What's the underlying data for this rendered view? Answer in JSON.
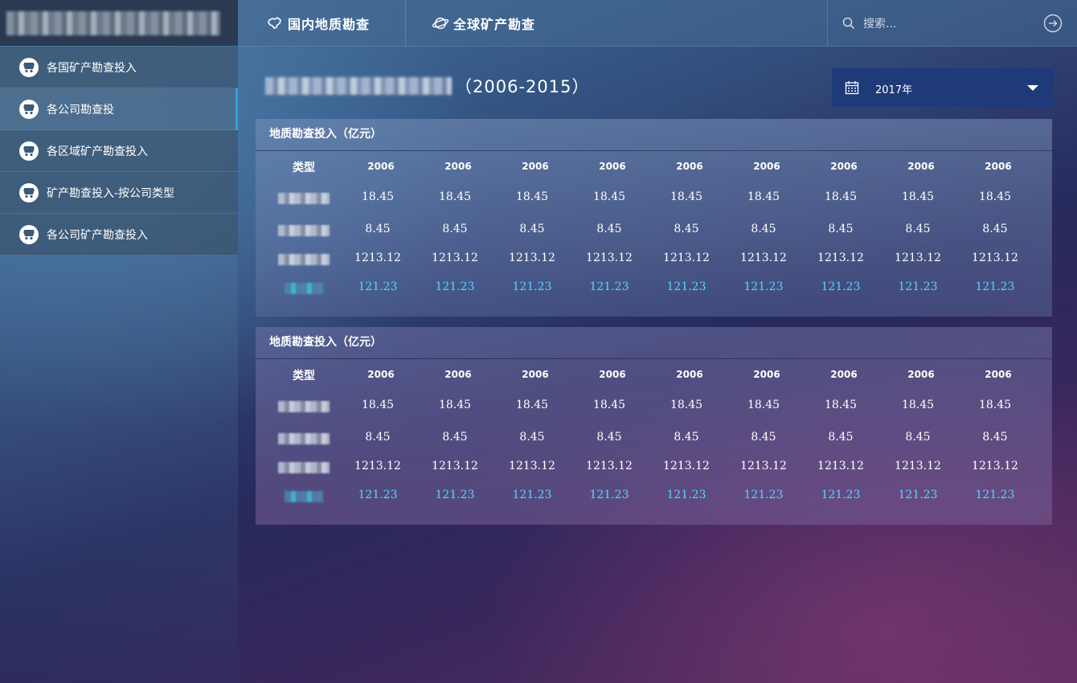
{
  "nav": {
    "tabs": [
      {
        "label": "国内地质勘查",
        "icon": "china-map-icon"
      },
      {
        "label": "全球矿产勘查",
        "icon": "globe-icon"
      }
    ],
    "search_placeholder": "搜索..."
  },
  "sidebar": {
    "items": [
      {
        "label": "各国矿产勘查投入",
        "active": false
      },
      {
        "label": "各公司勘查投",
        "active": true
      },
      {
        "label": "各区域矿产勘查投入",
        "active": false
      },
      {
        "label": "矿产勘查投入-按公司类型",
        "active": false
      },
      {
        "label": "各公司矿产勘查投入",
        "active": false
      }
    ]
  },
  "page": {
    "title_suffix": "（2006-2015）"
  },
  "year_select": {
    "value": "2017年"
  },
  "panels": [
    {
      "title": "地质勘查投入（亿元）",
      "header_type": "类型",
      "years": [
        "2006",
        "2006",
        "2006",
        "2006",
        "2006",
        "2006",
        "2006",
        "2006",
        "2006"
      ],
      "rows": [
        {
          "values": [
            "18.45",
            "18.45",
            "18.45",
            "18.45",
            "18.45",
            "18.45",
            "18.45",
            "18.45",
            "18.45"
          ],
          "highlight": false
        },
        {
          "values": [
            "8.45",
            "8.45",
            "8.45",
            "8.45",
            "8.45",
            "8.45",
            "8.45",
            "8.45",
            "8.45"
          ],
          "highlight": false
        },
        {
          "values": [
            "1213.12",
            "1213.12",
            "1213.12",
            "1213.12",
            "1213.12",
            "1213.12",
            "1213.12",
            "1213.12",
            "1213.12"
          ],
          "highlight": false
        },
        {
          "values": [
            "121.23",
            "121.23",
            "121.23",
            "121.23",
            "121.23",
            "121.23",
            "121.23",
            "121.23",
            "121.23"
          ],
          "highlight": true
        }
      ]
    },
    {
      "title": "地质勘查投入（亿元）",
      "header_type": "类型",
      "years": [
        "2006",
        "2006",
        "2006",
        "2006",
        "2006",
        "2006",
        "2006",
        "2006",
        "2006"
      ],
      "rows": [
        {
          "values": [
            "18.45",
            "18.45",
            "18.45",
            "18.45",
            "18.45",
            "18.45",
            "18.45",
            "18.45",
            "18.45"
          ],
          "highlight": false
        },
        {
          "values": [
            "8.45",
            "8.45",
            "8.45",
            "8.45",
            "8.45",
            "8.45",
            "8.45",
            "8.45",
            "8.45"
          ],
          "highlight": false
        },
        {
          "values": [
            "1213.12",
            "1213.12",
            "1213.12",
            "1213.12",
            "1213.12",
            "1213.12",
            "1213.12",
            "1213.12",
            "1213.12"
          ],
          "highlight": false
        },
        {
          "values": [
            "121.23",
            "121.23",
            "121.23",
            "121.23",
            "121.23",
            "121.23",
            "121.23",
            "121.23",
            "121.23"
          ],
          "highlight": true
        }
      ]
    }
  ],
  "colors": {
    "accent": "#2aa5e6",
    "highlight_value": "#4fd8ff",
    "select_bg": "#1f3a78"
  }
}
